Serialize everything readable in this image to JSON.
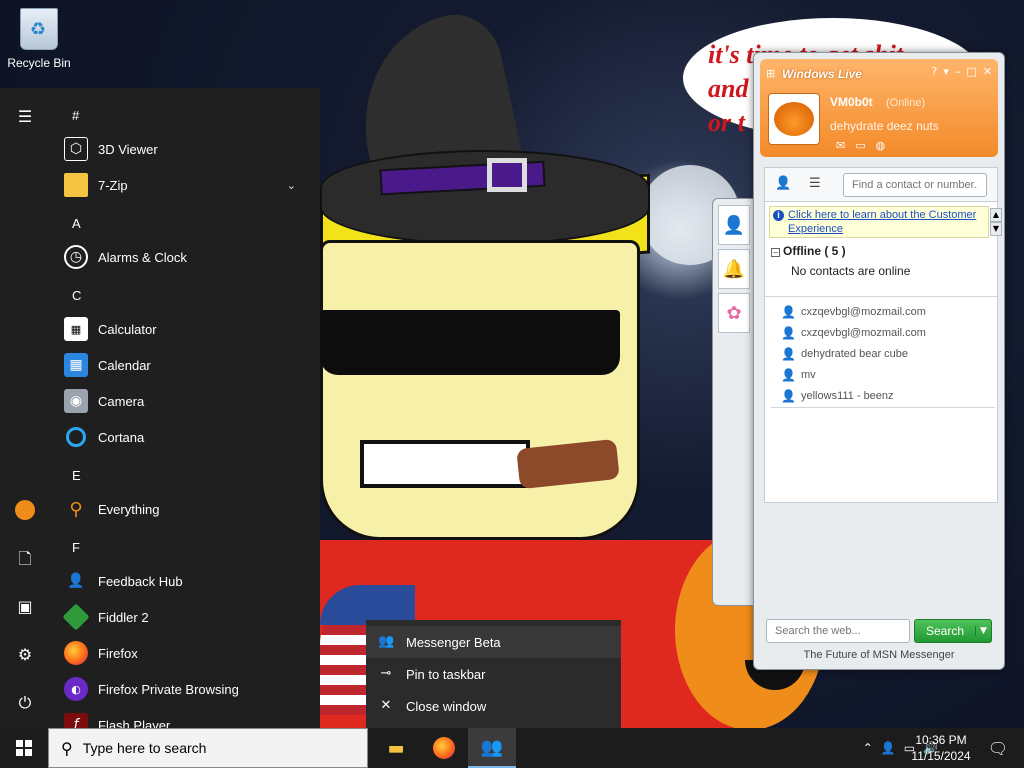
{
  "desktop": {
    "recycle_bin_label": "Recycle Bin",
    "wallpaper_text": "it's time to get shit and... or t..."
  },
  "start_menu": {
    "sections": [
      {
        "letter": "#",
        "apps": [
          {
            "label": "3D Viewer",
            "icon": "cube-icon"
          },
          {
            "label": "7-Zip",
            "icon": "folder-icon",
            "expandable": true
          }
        ]
      },
      {
        "letter": "A",
        "apps": [
          {
            "label": "Alarms & Clock",
            "icon": "alarm-clock-icon"
          }
        ]
      },
      {
        "letter": "C",
        "apps": [
          {
            "label": "Calculator",
            "icon": "calculator-icon"
          },
          {
            "label": "Calendar",
            "icon": "calendar-icon"
          },
          {
            "label": "Camera",
            "icon": "camera-icon"
          },
          {
            "label": "Cortana",
            "icon": "cortana-icon"
          }
        ]
      },
      {
        "letter": "E",
        "apps": [
          {
            "label": "Everything",
            "icon": "search-magnifier-icon"
          }
        ]
      },
      {
        "letter": "F",
        "apps": [
          {
            "label": "Feedback Hub",
            "icon": "feedback-hub-icon"
          },
          {
            "label": "Fiddler 2",
            "icon": "fiddler-icon"
          },
          {
            "label": "Firefox",
            "icon": "firefox-icon"
          },
          {
            "label": "Firefox Private Browsing",
            "icon": "firefox-private-icon"
          },
          {
            "label": "Flash Player",
            "icon": "flash-icon"
          }
        ]
      }
    ],
    "rail_icons": [
      "hamburger-menu-icon",
      "user-avatar-icon",
      "documents-icon",
      "pictures-icon",
      "settings-gear-icon",
      "power-icon"
    ]
  },
  "jump_list": {
    "items": [
      {
        "label": "Messenger Beta",
        "icon": "messenger-buddy-icon"
      },
      {
        "label": "Pin to taskbar",
        "icon": "pin-icon"
      },
      {
        "label": "Close window",
        "icon": "close-x-icon"
      }
    ]
  },
  "messenger": {
    "title": "Windows Live",
    "user": {
      "name": "VM0b0t",
      "status": "(Online)",
      "personal_message": "dehydrate deez nuts"
    },
    "search_contacts_placeholder": "Find a contact or number...",
    "info_bar": "Click here to learn about the Customer Experience",
    "group": {
      "name": "Offline ( 5 )",
      "empty_text": "No contacts are online"
    },
    "contacts": [
      "cxzqevbgl@mozmail.com",
      "cxzqevbgl@mozmail.com",
      "dehydrated bear cube",
      "mv",
      "yellows111 - beenz"
    ],
    "web_search_placeholder": "Search the web...",
    "search_button": "Search",
    "footer": "The Future of MSN Messenger",
    "colors": {
      "header": "#f38a2a",
      "search_button": "#239a32",
      "link": "#1a4fc4"
    }
  },
  "taskbar": {
    "search_placeholder": "Type here to search",
    "apps": [
      "file-explorer-icon",
      "firefox-icon",
      "messenger-icon"
    ],
    "time": "10:36 PM",
    "date": "11/15/2024"
  }
}
